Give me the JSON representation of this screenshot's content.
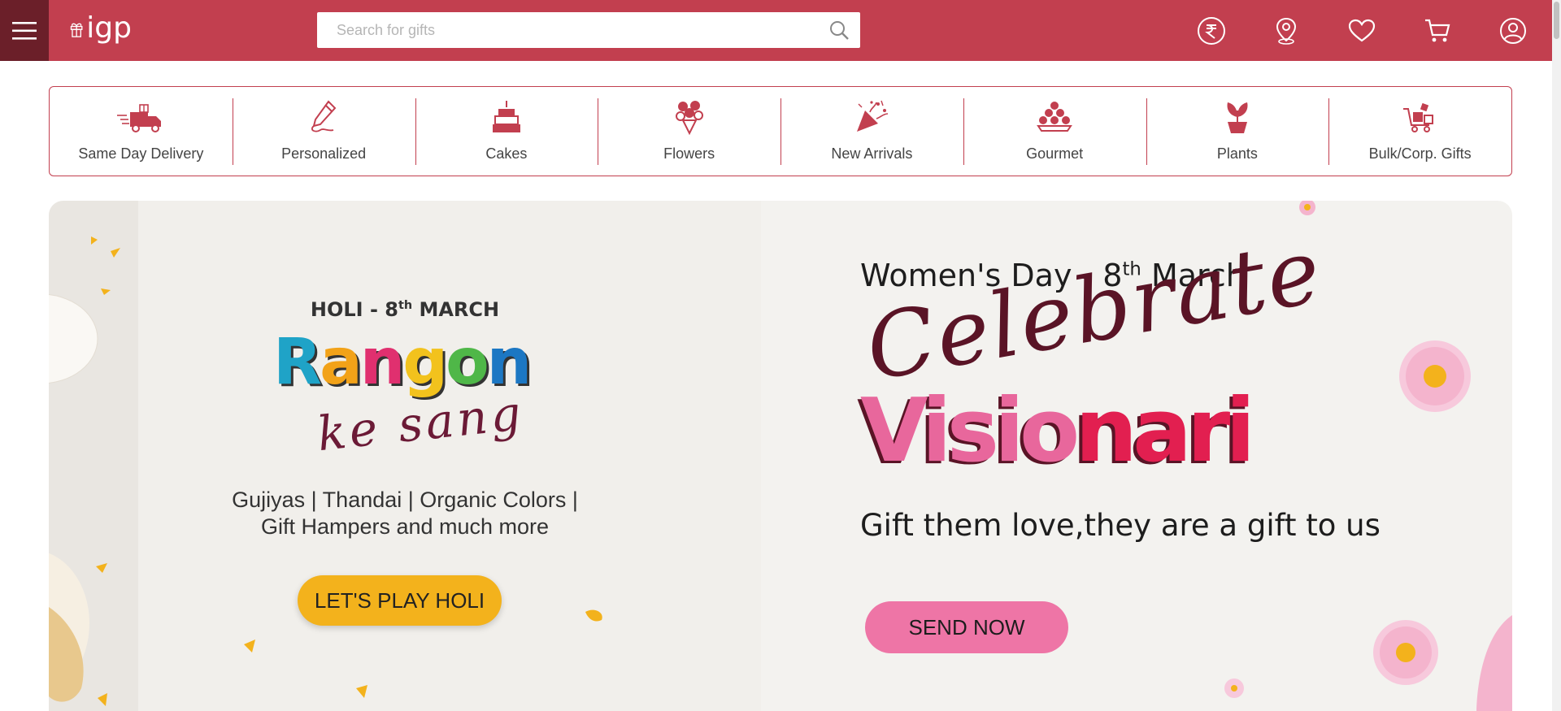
{
  "header": {
    "logo_text": "igp",
    "search": {
      "placeholder": "Search for gifts"
    },
    "icons": [
      "menu-icon",
      "rupee-icon",
      "location-icon",
      "heart-icon",
      "cart-icon",
      "account-icon"
    ]
  },
  "categories": [
    {
      "label": "Same Day Delivery",
      "icon": "delivery-truck-icon"
    },
    {
      "label": "Personalized",
      "icon": "pencil-icon"
    },
    {
      "label": "Cakes",
      "icon": "cake-icon"
    },
    {
      "label": "Flowers",
      "icon": "flower-bouquet-icon"
    },
    {
      "label": "New Arrivals",
      "icon": "party-popper-icon"
    },
    {
      "label": "Gourmet",
      "icon": "sweets-platter-icon"
    },
    {
      "label": "Plants",
      "icon": "plant-pot-icon"
    },
    {
      "label": "Bulk/Corp. Gifts",
      "icon": "gift-cart-icon"
    }
  ],
  "banners": {
    "holi": {
      "top_line": "HOLI - 8",
      "top_sup": "th",
      "top_end": " MARCH",
      "title_letters": [
        "R",
        "a",
        "n",
        "g",
        "o",
        "n"
      ],
      "subtitle": "ke sang",
      "desc_line1": "Gujiyas | Thandai | Organic Colors |",
      "desc_line2": "Gift Hampers and much more",
      "button": "LET'S PLAY HOLI"
    },
    "womens_day": {
      "top_line": "Women's Day - 8",
      "top_sup": "th",
      "top_end": " March",
      "script": "Celebrate",
      "title_part1": "Visio",
      "title_part2": "nari",
      "tagline": "Gift them love,they are a gift to us",
      "button": "SEND NOW"
    }
  },
  "colors": {
    "brand": "#c23f4f",
    "menu_bg": "#6b1f29",
    "holi_button": "#f3b21c",
    "womens_button": "#ee75a6",
    "rangon_palette": [
      "#1fa3c7",
      "#f2a218",
      "#e0306f",
      "#f2c21d",
      "#4fb748",
      "#1c77c3"
    ]
  }
}
